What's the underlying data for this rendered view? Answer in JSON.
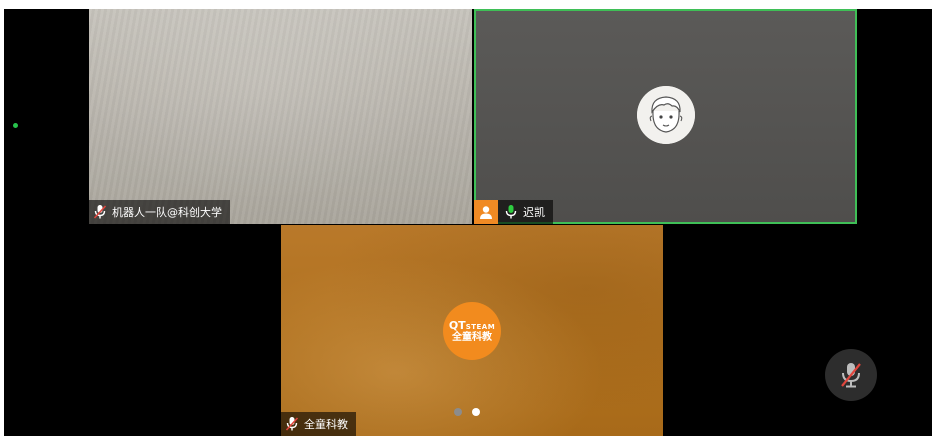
{
  "participants": [
    {
      "name": "机器人一队@科创大学",
      "mic": "muted"
    },
    {
      "name": "迟凯",
      "mic": "active",
      "speaking": true,
      "avatar_icon": "cartoon-face-avatar",
      "badge_icon": "person-icon"
    },
    {
      "name": "全童科教",
      "mic": "muted",
      "logo": {
        "top": "QT",
        "top_small": "STEAM",
        "bottom": "全童科教"
      }
    }
  ],
  "pager": {
    "total": 2,
    "current": 2
  },
  "controls": {
    "mute_icon": "mic-off-icon"
  },
  "colors": {
    "speaking_border": "#3fbf57",
    "badge": "#f08a24",
    "logo": "#f28b1e",
    "mic_active": "#2ecc40",
    "mic_muted_slash": "#e0463d"
  }
}
